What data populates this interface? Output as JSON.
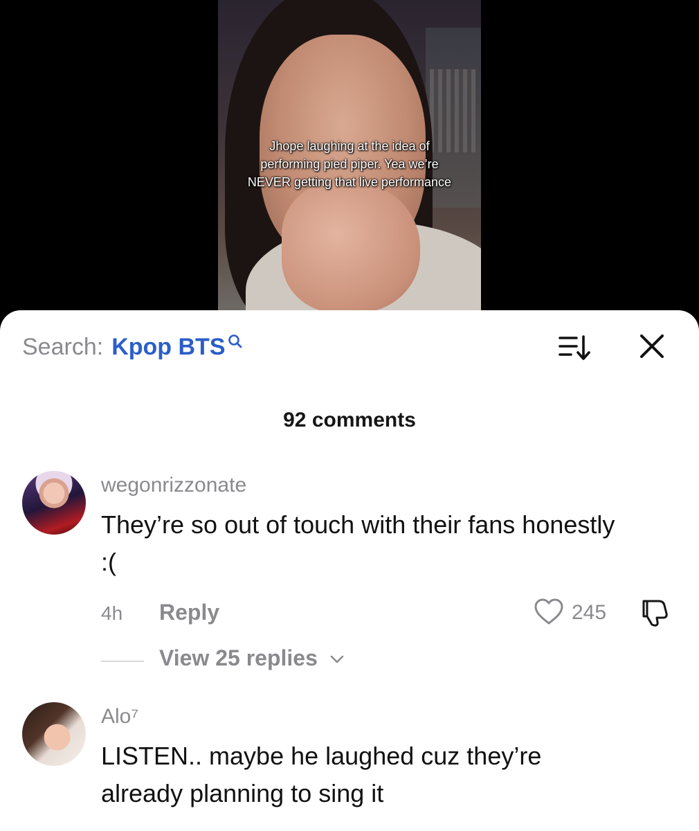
{
  "video": {
    "caption": "Jhope laughing at the idea of performing pied piper. Yea we’re NEVER getting that live performance"
  },
  "search": {
    "prefix": "Search:",
    "query": "Kpop BTS"
  },
  "icons": {
    "search": "search-icon",
    "sort": "sort-icon",
    "close": "close-icon",
    "like": "heart-icon",
    "dislike": "dislike-icon",
    "expand": "chevron-down-icon"
  },
  "comments_header": {
    "count_label": "92 comments"
  },
  "comments": [
    {
      "username": "wegonrizzonate",
      "text": "They’re so out of touch with their fans honestly :(",
      "time": "4h",
      "reply_label": "Reply",
      "likes": "245",
      "view_replies_label": "View 25 replies"
    },
    {
      "username": "Alo⁷",
      "text": "LISTEN.. maybe he laughed cuz they’re already planning to sing it"
    }
  ],
  "colors": {
    "accent_link": "#2b5ec9",
    "muted_text": "#8a8a8e",
    "primary_text": "#111111",
    "sheet_bg": "#ffffff"
  }
}
